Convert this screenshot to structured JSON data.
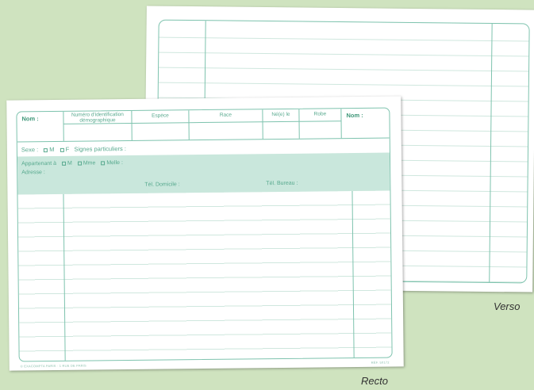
{
  "recto": {
    "header": {
      "nom_left": "Nom :",
      "numero": "Numéro d'identification démographique",
      "espece": "Espèce",
      "race": "Race",
      "ne_le": "Né(e) le",
      "robe": "Robe",
      "nom_right": "Nom :"
    },
    "sexe": {
      "label": "Sexe :",
      "option_m": "M",
      "option_f": "F",
      "signes": "Signes particuliers :"
    },
    "owner": {
      "appartenant": "Appartenant à",
      "option_m": "M",
      "option_mme": "Mme",
      "option_melle": "Melle :",
      "adresse": "Adresse :",
      "tel_domicile": "Tél. Domicile :",
      "tel_bureau": "Tél. Bureau :"
    },
    "footer_left": "© EXACOMPTA PARIS · 1 RUE DE PARIS",
    "footer_right": "RÉF. 50172"
  },
  "captions": {
    "verso": "Verso",
    "recto": "Recto"
  },
  "colors": {
    "background": "#cfe3bf",
    "line": "#7ec3ae",
    "band": "#c9e7dc",
    "text": "#57a98e"
  }
}
